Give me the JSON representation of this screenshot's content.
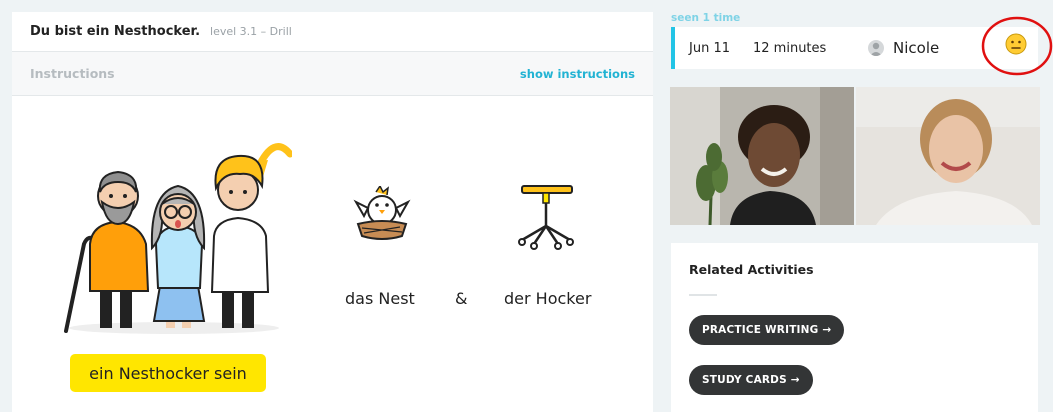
{
  "lesson": {
    "title": "Du bist ein Nesthocker.",
    "level": "level 3.1 – Drill",
    "instructions_label": "Instructions",
    "show_instructions_label": "show instructions",
    "words": {
      "nest": "das Nest",
      "ampersand": "&",
      "hocker": "der Hocker"
    },
    "idiom": "ein Nesthocker sein"
  },
  "session": {
    "seen_label": "seen 1 time",
    "date": "Jun 11",
    "duration": "12 minutes",
    "tutor_name": "Nicole",
    "rating_icon": "neutral-face-emoji",
    "highlight_color": "#e01010",
    "accent_color": "#22c4e6"
  },
  "video": {
    "participants": [
      "student",
      "tutor"
    ]
  },
  "related": {
    "title": "Related Activities",
    "activities": [
      {
        "label": "PRACTICE WRITING →"
      },
      {
        "label": "STUDY CARDS →"
      }
    ]
  }
}
